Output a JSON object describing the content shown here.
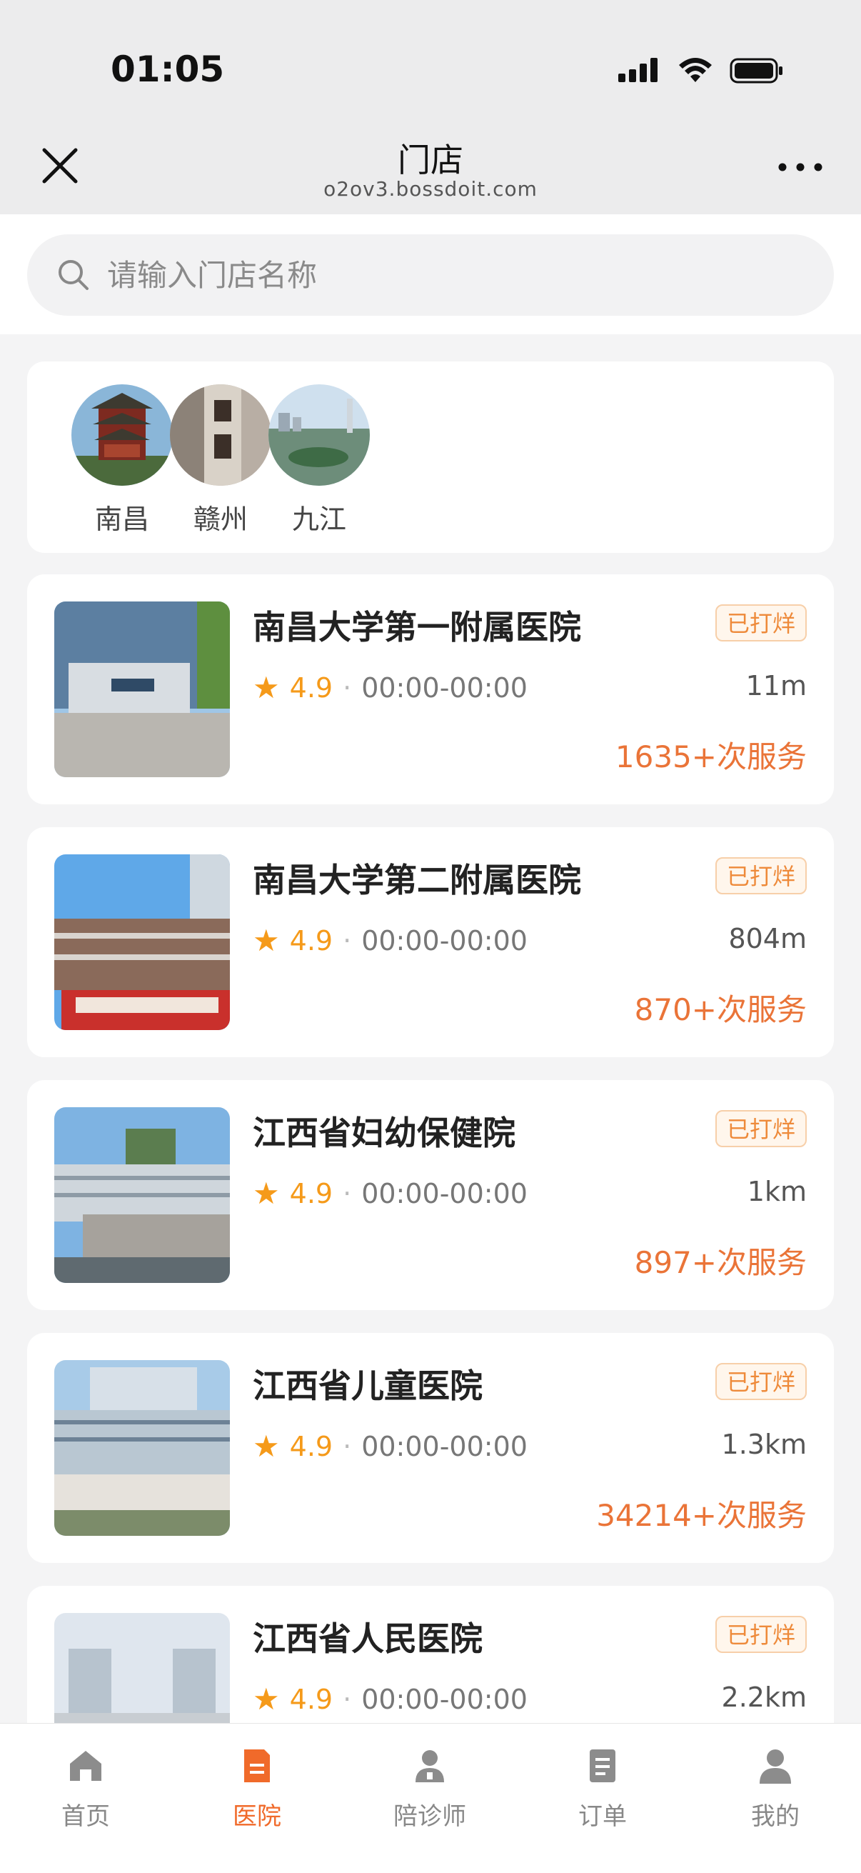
{
  "status_bar": {
    "time": "01:05"
  },
  "nav": {
    "title": "门店",
    "subtitle": "o2ov3.bossdoit.com"
  },
  "search": {
    "placeholder": "请输入门店名称",
    "value": ""
  },
  "cities": [
    {
      "name": "南昌"
    },
    {
      "name": "赣州"
    },
    {
      "name": "九江"
    }
  ],
  "hospitals": [
    {
      "name": "南昌大学第一附属医院",
      "badge": "已打烊",
      "rating": "4.9",
      "hours": "00:00-00:00",
      "distance": "11m",
      "served": "1635+次服务"
    },
    {
      "name": "南昌大学第二附属医院",
      "badge": "已打烊",
      "rating": "4.9",
      "hours": "00:00-00:00",
      "distance": "804m",
      "served": "870+次服务"
    },
    {
      "name": "江西省妇幼保健院",
      "badge": "已打烊",
      "rating": "4.9",
      "hours": "00:00-00:00",
      "distance": "1km",
      "served": "897+次服务"
    },
    {
      "name": "江西省儿童医院",
      "badge": "已打烊",
      "rating": "4.9",
      "hours": "00:00-00:00",
      "distance": "1.3km",
      "served": "34214+次服务"
    },
    {
      "name": "江西省人民医院",
      "badge": "已打烊",
      "rating": "4.9",
      "hours": "00:00-00:00",
      "distance": "2.2km",
      "served": ""
    }
  ],
  "tabs": [
    {
      "label": "首页",
      "icon": "home-icon"
    },
    {
      "label": "医院",
      "icon": "hospital-icon"
    },
    {
      "label": "陪诊师",
      "icon": "escort-icon"
    },
    {
      "label": "订单",
      "icon": "order-icon"
    },
    {
      "label": "我的",
      "icon": "profile-icon"
    }
  ],
  "active_tab": "医院",
  "colors": {
    "accent": "#f06a2a",
    "star": "#f59a1a",
    "badge": "#ee8a3a"
  }
}
